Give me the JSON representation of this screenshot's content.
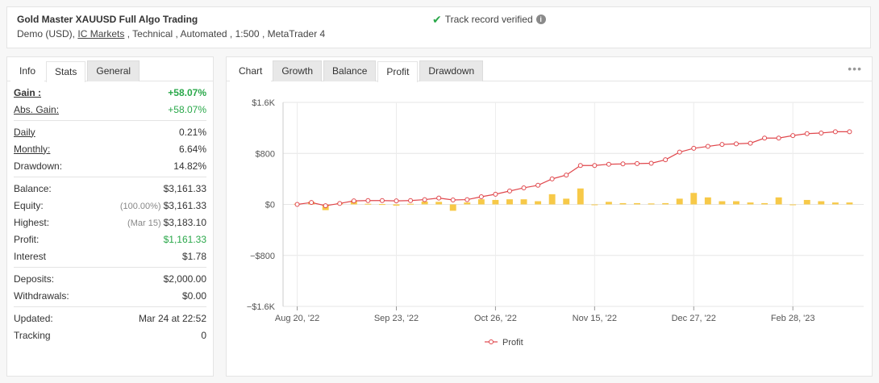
{
  "header": {
    "system_title": "Gold Master XAUUSD Full Algo Trading",
    "account_type": "Demo (USD),",
    "broker": "IC Markets",
    "details": ", Technical , Automated , 1:500 , MetaTrader 4",
    "verified": "Track record verified",
    "info_glyph": "i"
  },
  "left_tabs": [
    "Info",
    "Stats",
    "General"
  ],
  "stats": {
    "gain": {
      "label": "Gain :",
      "value": "+58.07%"
    },
    "abs_gain": {
      "label": "Abs. Gain:",
      "value": "+58.07%"
    },
    "daily": {
      "label": "Daily",
      "value": "0.21%"
    },
    "monthly": {
      "label": "Monthly:",
      "value": "6.64%"
    },
    "drawdown": {
      "label": "Drawdown:",
      "value": "14.82%"
    },
    "balance": {
      "label": "Balance:",
      "value": "$3,161.33"
    },
    "equity": {
      "label": "Equity:",
      "note": "(100.00%)",
      "value": "$3,161.33"
    },
    "highest": {
      "label": "Highest:",
      "note": "(Mar 15)",
      "value": "$3,183.10"
    },
    "profit": {
      "label": "Profit:",
      "value": "$1,161.33"
    },
    "interest": {
      "label": "Interest",
      "value": "$1.78"
    },
    "deposits": {
      "label": "Deposits:",
      "value": "$2,000.00"
    },
    "withdrawals": {
      "label": "Withdrawals:",
      "value": "$0.00"
    },
    "updated": {
      "label": "Updated:",
      "value": "Mar 24 at 22:52"
    },
    "tracking": {
      "label": "Tracking",
      "value": "0"
    }
  },
  "chart_tabs": [
    "Chart",
    "Growth",
    "Balance",
    "Profit",
    "Drawdown"
  ],
  "more_glyph": "•••",
  "chart_data": {
    "type": "line",
    "y_tick_labels": [
      "$1.6K",
      "$800",
      "$0",
      "−$800",
      "−$1.6K"
    ],
    "x_tick_labels": [
      "Aug 20, '22",
      "Sep 23, '22",
      "Oct 26, '22",
      "Nov 15, '22",
      "Dec 27, '22",
      "Feb 28, '23"
    ],
    "ylim": [
      -1600,
      1600
    ],
    "legend": "Profit",
    "line_color": "#e0474c",
    "bar_color": "#f7c948",
    "series": [
      {
        "name": "Profit",
        "values": [
          0,
          30,
          -20,
          15,
          55,
          60,
          60,
          55,
          60,
          75,
          100,
          70,
          75,
          120,
          160,
          210,
          260,
          300,
          400,
          460,
          610,
          610,
          630,
          635,
          640,
          645,
          700,
          820,
          880,
          910,
          940,
          950,
          960,
          1040,
          1040,
          1080,
          1110,
          1120,
          1140,
          1140
        ]
      },
      {
        "values": [
          10,
          40,
          -90,
          20,
          60,
          10,
          5,
          -20,
          10,
          45,
          40,
          -100,
          30,
          80,
          70,
          80,
          80,
          50,
          160,
          90,
          250,
          0,
          40,
          20,
          20,
          15,
          20,
          90,
          180,
          110,
          50,
          50,
          30,
          20,
          110,
          0,
          70,
          50,
          30,
          30
        ]
      }
    ]
  }
}
